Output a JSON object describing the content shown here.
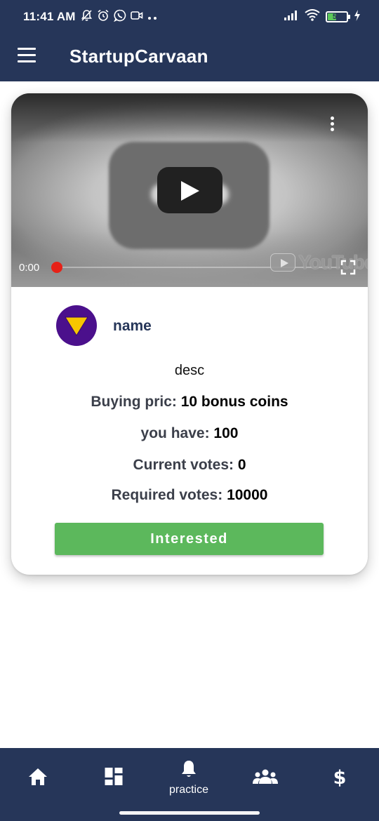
{
  "status_bar": {
    "time": "11:41 AM",
    "battery": "50",
    "icons_left": [
      "bell-off-icon",
      "alarm-icon",
      "whatsapp-icon",
      "camera-icon",
      "more-dots-icon"
    ],
    "icons_right": [
      "signal-icon",
      "wifi-icon",
      "battery-icon",
      "charging-icon"
    ]
  },
  "app_bar": {
    "title": "StartupCarvaan"
  },
  "video": {
    "time": "0:00",
    "progress": 0,
    "brand": "YouTube"
  },
  "item": {
    "name": "name",
    "desc": "desc",
    "buying_label": "Buying pric: ",
    "buying_value": "10 bonus coins",
    "have_label": "you have: ",
    "have_value": "100",
    "current_label": "Current votes: ",
    "current_value": "0",
    "required_label": "Required votes: ",
    "required_value": "10000",
    "button_label": "Interested"
  },
  "bottom_nav": {
    "items": [
      {
        "icon": "home-icon",
        "label": ""
      },
      {
        "icon": "dashboard-icon",
        "label": ""
      },
      {
        "icon": "bell-icon",
        "label": "practice"
      },
      {
        "icon": "group-icon",
        "label": ""
      },
      {
        "icon": "dollar-icon",
        "label": ""
      }
    ]
  },
  "colors": {
    "primary": "#263659",
    "accent_green": "#5cb85c",
    "avatar_bg": "#4b108c",
    "avatar_triangle": "#f7c600",
    "video_progress": "#e62117"
  }
}
